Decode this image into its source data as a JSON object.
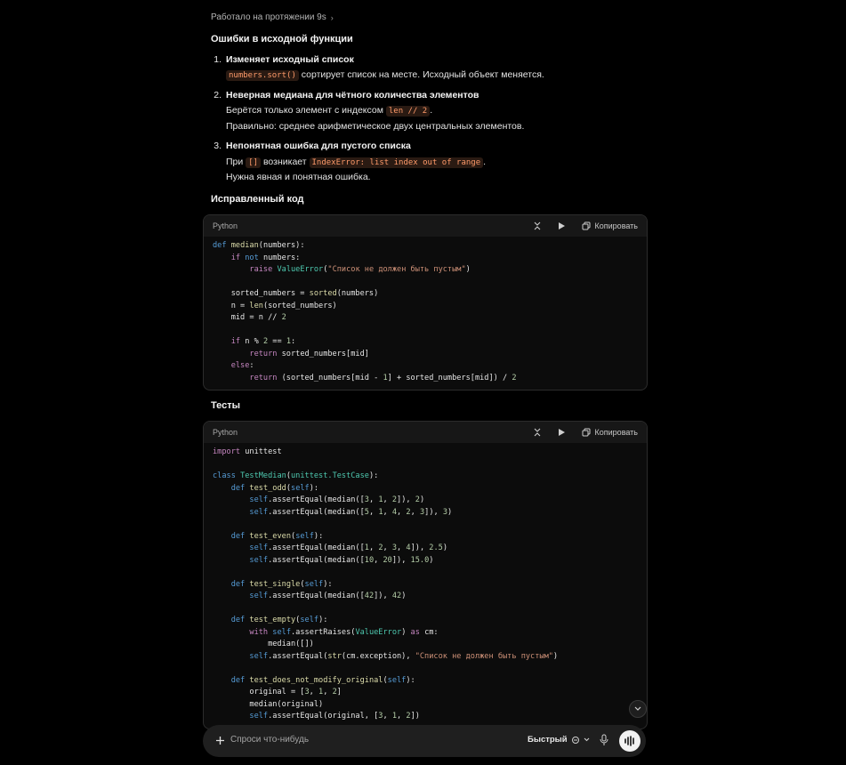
{
  "worked": {
    "label": "Работало на протяжении 9s",
    "chevron": "›"
  },
  "sections": {
    "errors_title": "Ошибки в исходной функции",
    "fixed_title": "Исправленный код",
    "tests_title": "Тесты"
  },
  "errors": [
    {
      "num": "1.",
      "title": "Изменяет исходный список",
      "code": "numbers.sort()",
      "text": "сортирует список на месте. Исходный объект меняется."
    },
    {
      "num": "2.",
      "title": "Неверная медиана для чётного количества элементов",
      "line1_pre": "Берётся только элемент с индексом",
      "line1_code": "len // 2",
      "line1_post": ".",
      "line2": "Правильно: среднее арифметическое двух центральных элементов."
    },
    {
      "num": "3.",
      "title": "Непонятная ошибка для пустого списка",
      "line1_pre": "При",
      "line1_code1": "[]",
      "line1_mid": "возникает",
      "line1_code2": "IndexError: list index out of range",
      "line1_post": ".",
      "line2": "Нужна явная и понятная ошибка."
    }
  ],
  "codeblocks": {
    "lang": "Python",
    "copy": "Копировать"
  },
  "composer": {
    "placeholder": "Спроси что-нибудь",
    "mode": "Быстрый"
  },
  "icons": [
    "chevron-right-icon",
    "collapse-icon",
    "run-icon",
    "copy-icon",
    "chevron-down-icon",
    "plus-icon",
    "mic-icon",
    "voice-icon",
    "model-icon"
  ]
}
